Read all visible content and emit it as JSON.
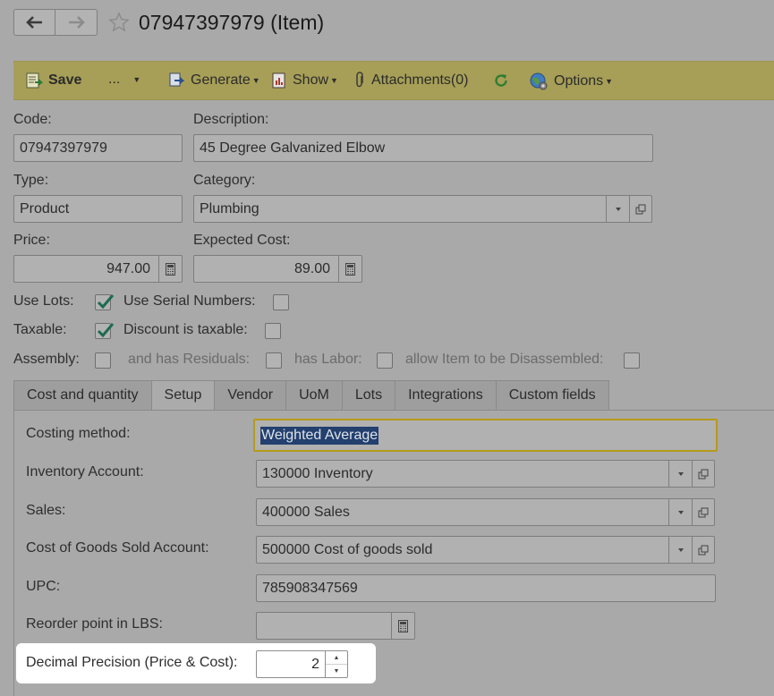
{
  "header": {
    "title": "07947397979 (Item)"
  },
  "toolbar": {
    "save": "Save",
    "more": "...",
    "generate": "Generate",
    "show": "Show",
    "attachments": "Attachments(0)",
    "options": "Options"
  },
  "form": {
    "code_label": "Code:",
    "code_value": "07947397979",
    "description_label": "Description:",
    "description_value": "45 Degree Galvanized Elbow",
    "type_label": "Type:",
    "type_value": "Product",
    "category_label": "Category:",
    "category_value": "Plumbing",
    "price_label": "Price:",
    "price_value": "947.00",
    "expected_cost_label": "Expected Cost:",
    "expected_cost_value": "89.00",
    "use_lots_label": "Use Lots:",
    "use_lots_checked": true,
    "use_serial_label": "Use Serial Numbers:",
    "use_serial_checked": false,
    "taxable_label": "Taxable:",
    "taxable_checked": true,
    "discount_taxable_label": "Discount is taxable:",
    "discount_taxable_checked": false,
    "assembly_label": "Assembly:",
    "has_residuals_label": "and has Residuals:",
    "has_labor_label": "has Labor:",
    "allow_disassembled_label": "allow Item to be Disassembled:"
  },
  "tabs": [
    {
      "label": "Cost and quantity",
      "active": false
    },
    {
      "label": "Setup",
      "active": true
    },
    {
      "label": "Vendor",
      "active": false
    },
    {
      "label": "UoM",
      "active": false
    },
    {
      "label": "Lots",
      "active": false
    },
    {
      "label": "Integrations",
      "active": false
    },
    {
      "label": "Custom fields",
      "active": false
    }
  ],
  "setup": {
    "costing_method_label": "Costing method:",
    "costing_method_value": "Weighted Average",
    "inventory_account_label": "Inventory Account:",
    "inventory_account_value": "130000 Inventory",
    "sales_label": "Sales:",
    "sales_value": "400000 Sales",
    "cogs_label": "Cost of Goods Sold Account:",
    "cogs_value": "500000 Cost of goods sold",
    "upc_label": "UPC:",
    "upc_value": "785908347569",
    "reorder_label": "Reorder point in LBS:",
    "reorder_value": "",
    "decimal_precision_label": "Decimal Precision (Price & Cost):",
    "decimal_precision_value": "2"
  },
  "colors": {
    "toolbar_bg": "#a79f57",
    "focus_border": "#b69a1b",
    "selection": "#23406e",
    "check_green": "#1c6b52"
  }
}
